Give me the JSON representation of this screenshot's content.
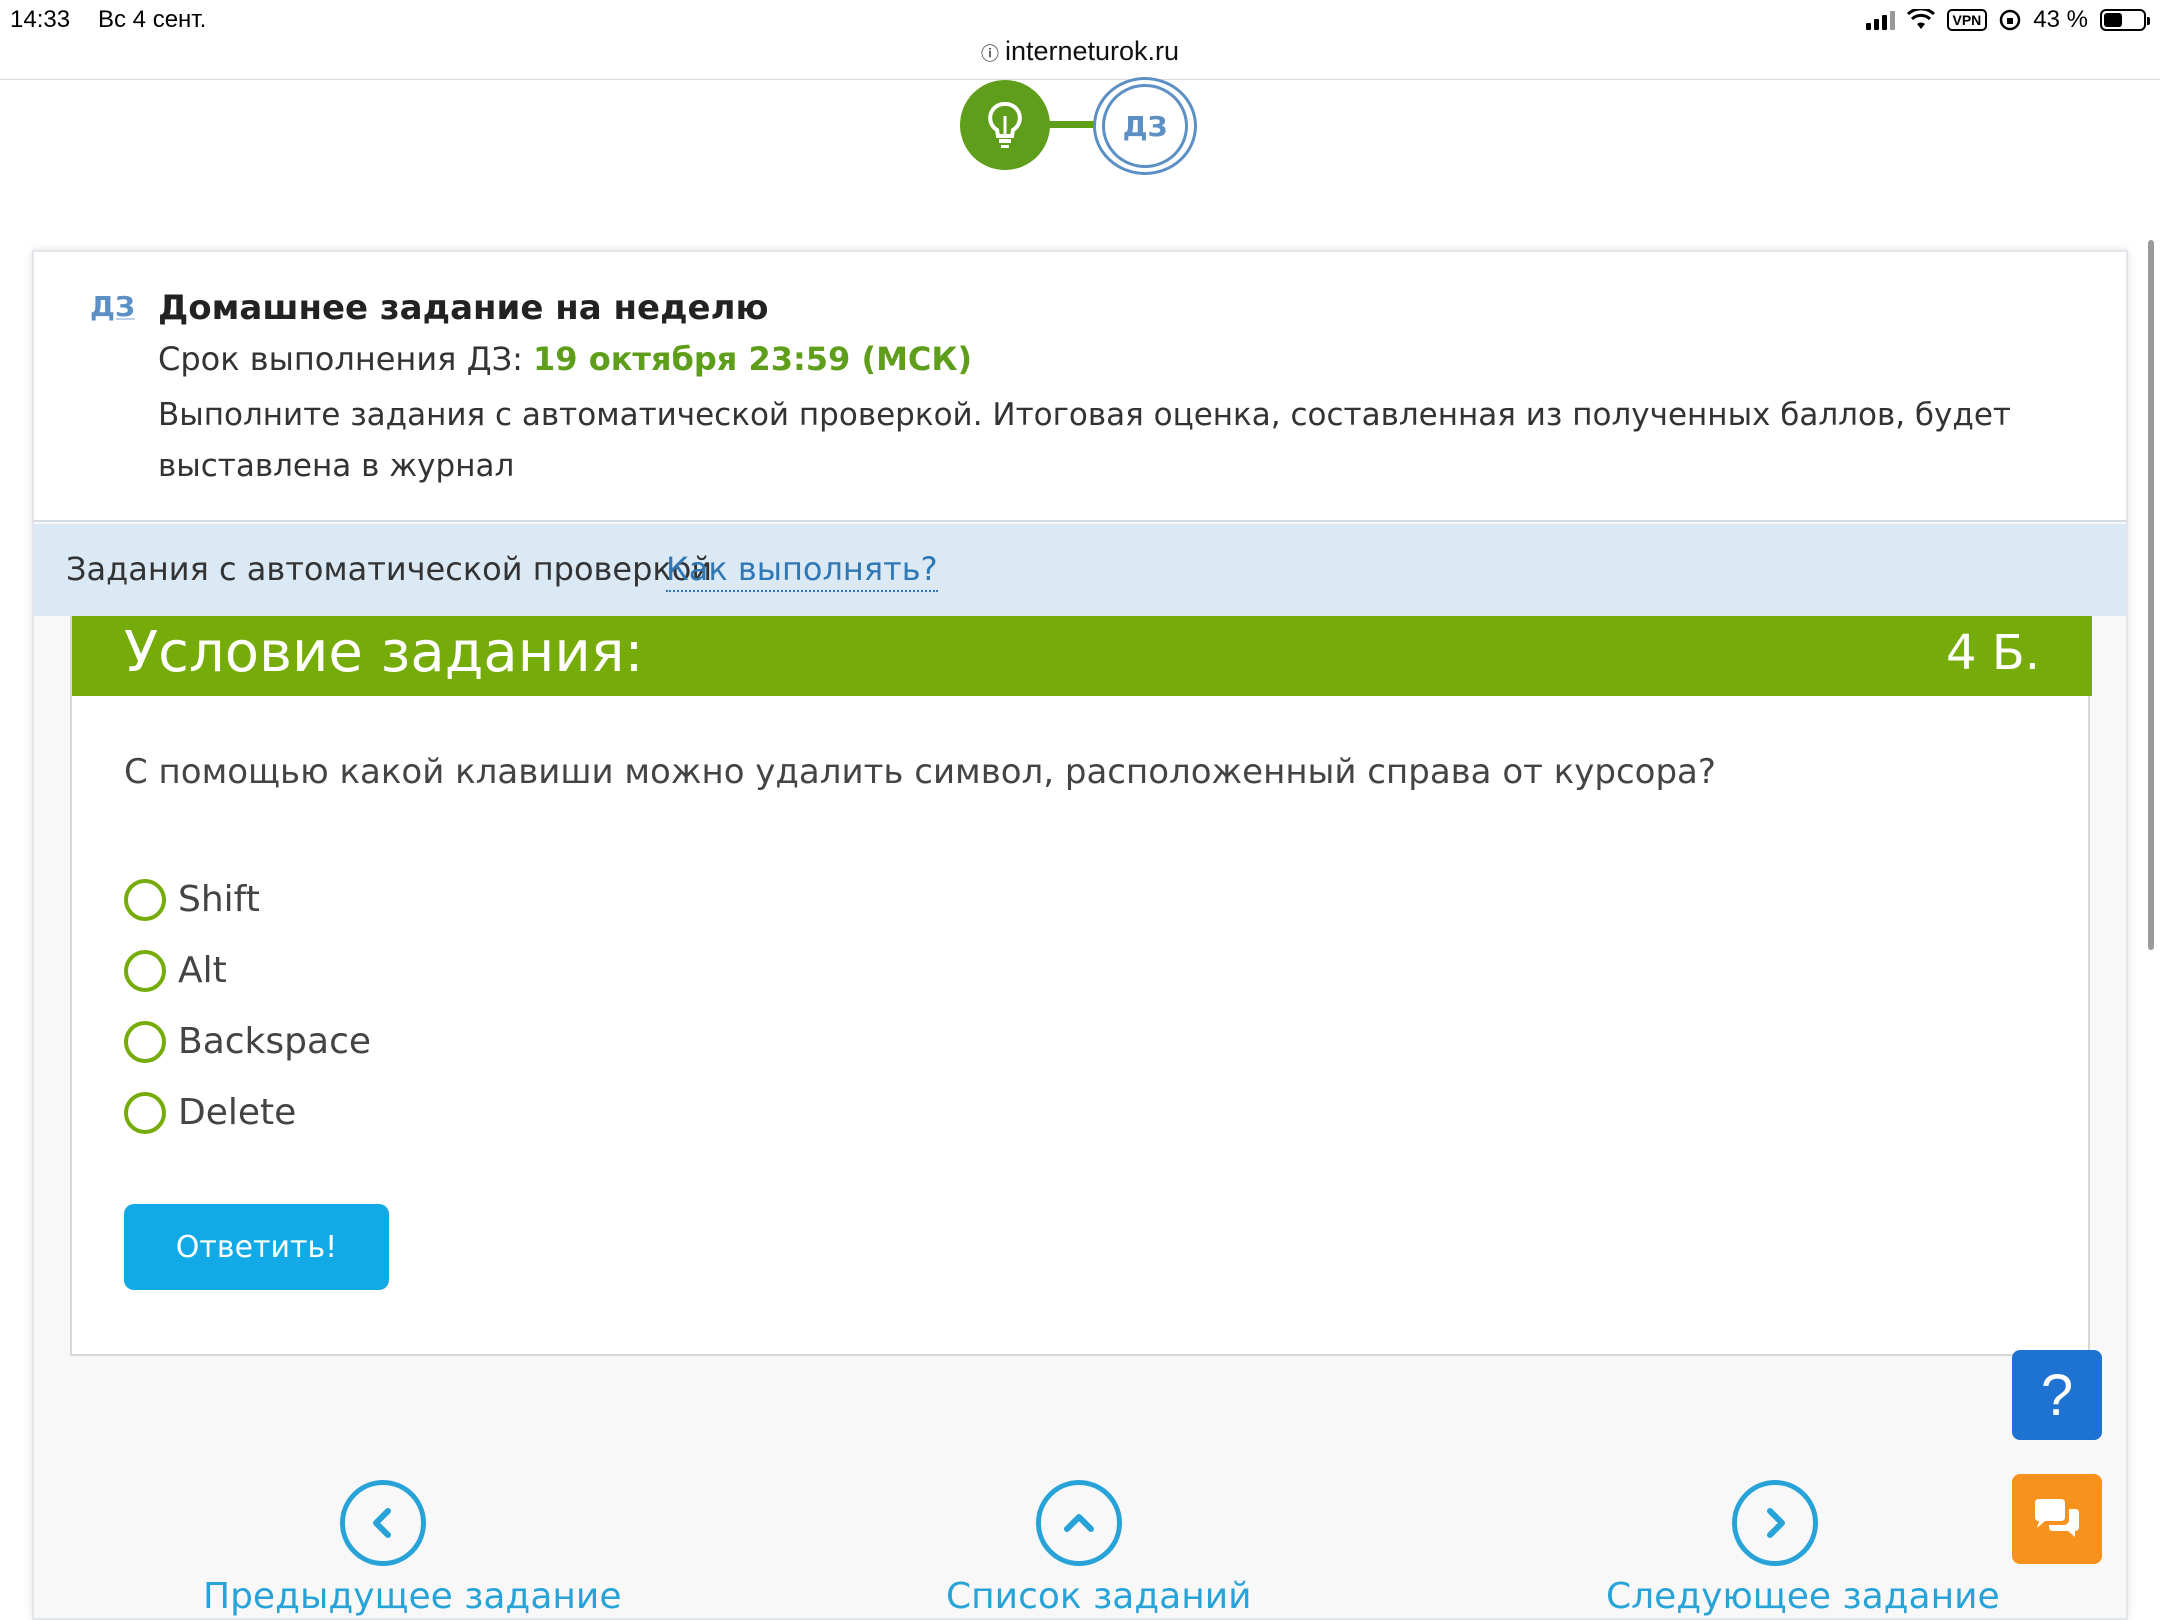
{
  "status_bar": {
    "time": "14:33",
    "date": "Вс 4 сент.",
    "vpn": "VPN",
    "battery": "43 %"
  },
  "browser": {
    "url": "interneturok.ru"
  },
  "steps": {
    "homework_badge": "ДЗ"
  },
  "homework": {
    "badge": "ДЗ",
    "title": "Домашнее задание на неделю",
    "deadline_label": "Срок выполнения ДЗ:",
    "deadline_value": "19 октября 23:59 (МСК)",
    "description": "Выполните задания с автоматической проверкой. Итоговая оценка, составленная из полученных баллов, будет выставлена в журнал"
  },
  "tasks_bar": {
    "label": "Задания с автоматической проверкой",
    "how_link": "Как выполнять?"
  },
  "task": {
    "title": "Условие задания:",
    "points": "4 Б.",
    "question": "С помощью какой клавиши можно удалить символ, расположенный справа от курсора?",
    "options": [
      "Shift",
      "Alt",
      "Backspace",
      "Delete"
    ],
    "answer_button": "Ответить!"
  },
  "nav": {
    "prev": "Предыдущее задание",
    "list": "Список заданий",
    "next": "Следующее задание"
  },
  "widgets": {
    "help": "?"
  },
  "colors": {
    "green": "#76ac0a",
    "blue_link": "#2f78b5",
    "answer_button": "#12aae6",
    "help_button": "#1d72d2",
    "chat_button": "#f7921e"
  }
}
